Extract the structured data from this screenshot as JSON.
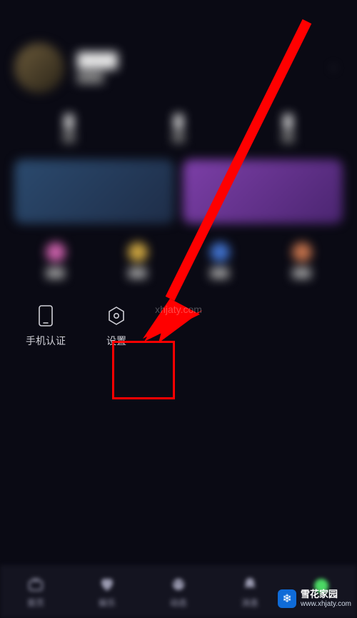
{
  "actions": {
    "phone_auth": {
      "label": "手机认证"
    },
    "settings": {
      "label": "设置"
    }
  },
  "nav": {
    "home": {
      "label": "首页"
    },
    "ent": {
      "label": "娱乐"
    },
    "dynamic": {
      "label": "动态"
    },
    "message": {
      "label": "消息"
    }
  },
  "feat_colors": {
    "a": "#c85fa8",
    "b": "#c9a23f",
    "c": "#3f6fc9",
    "d": "#c0704a"
  },
  "watermark": {
    "center": "xhjaty.com",
    "brand_top": "雪花家园",
    "brand_bottom": "www.xhjaty.com"
  }
}
